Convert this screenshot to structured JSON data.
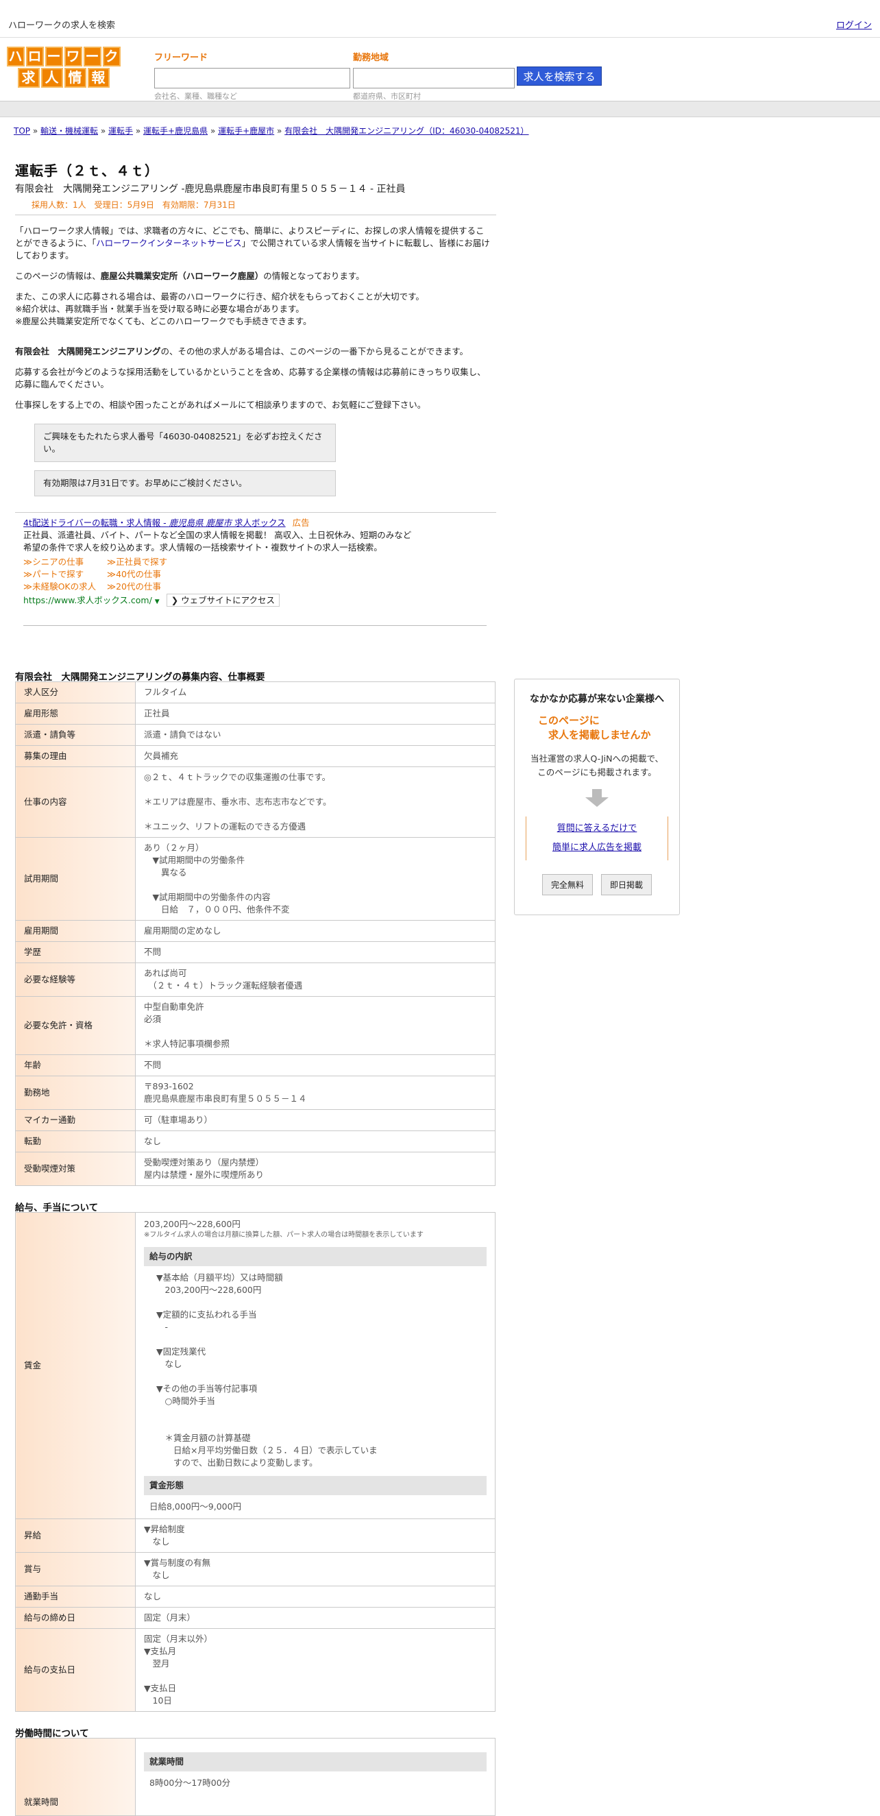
{
  "top": {
    "site_title": "ハローワークの求人を検索",
    "login": "ログイン"
  },
  "logo": {
    "row1": [
      "ハ",
      "ロ",
      "ー",
      "ワ",
      "ー",
      "ク"
    ],
    "row2": [
      "求",
      "人",
      "情",
      "報"
    ]
  },
  "search": {
    "keyword_label": "フリーワード",
    "keyword_placeholder": "会社名、業種、職種など",
    "keyword_value": "",
    "area_label": "勤務地域",
    "area_placeholder": "都道府県、市区町村",
    "area_value": "",
    "button": "求人を検索する"
  },
  "breadcrumb": {
    "items": [
      "TOP",
      "輸送・機械運転",
      "運転手",
      "運転手+鹿児島県",
      "運転手+鹿屋市",
      "有限会社　大隅開発エンジニアリング（ID：46030-04082521）"
    ],
    "sep": "»"
  },
  "job": {
    "title": "運転手（２ｔ、４ｔ）",
    "subtitle": "有限会社　大隅開発エンジニアリング -鹿児島県鹿屋市串良町有里５０５５－１４ - 正社員",
    "meta": "採用人数：1人　受理日：5月9日　有効期限：7月31日"
  },
  "intro": {
    "p1a": "「ハローワーク求人情報」では、求職者の方々に、どこでも、簡単に、よりスピーディに、お探しの求人情報を提供することができるように、「",
    "p1link": "ハローワークインターネットサービス",
    "p1b": "」で公開されている求人情報を当サイトに転載し、皆様にお届けしております。",
    "p2a": "このページの情報は、",
    "p2b": "鹿屋公共職業安定所（ハローワーク鹿屋）",
    "p2c": "の情報となっております。",
    "p3": "また、この求人に応募される場合は、最寄のハローワークに行き、紹介状をもらっておくことが大切です。",
    "p3b": "※紹介状は、再就職手当・就業手当を受け取る時に必要な場合があります。",
    "p3c": "※鹿屋公共職業安定所でなくても、どこのハローワークでも手続きできます。",
    "p4a": "有限会社　大隅開発エンジニアリング",
    "p4b": "の、その他の求人がある場合は、このページの一番下から見ることができます。",
    "p5": "応募する会社が今どのような採用活動をしているかということを含め、応募する企業様の情報は応募前にきっちり収集し、応募に臨んでください。",
    "p6": "仕事探しをする上での、相談や困ったことがあればメールにて相談承りますので、お気軽にご登録下さい。"
  },
  "notes": {
    "n1": "ご興味をもたれたら求人番号「46030-04082521」を必ずお控えください。",
    "n2": "有効期限は7月31日です。お早めにご検討ください。"
  },
  "ad": {
    "title_a": "4t配送ドライバーの転職・求人情報 - ",
    "title_b": "鹿児島県 鹿屋市",
    "title_c": " 求人ボックス",
    "badge": "広告",
    "desc1": "正社員、派遣社員、バイト、パートなど全国の求人情報を掲載！ 高収入、土日祝休み、短期のみなど",
    "desc2": "希望の条件で求人を絞り込めます。求人情報の一括検索サイト・複数サイトの求人一括検索。",
    "links": [
      "≫シニアの仕事",
      "≫正社員で探す",
      "≫パートで探す",
      "≫40代の仕事",
      "≫未経験OKの求人",
      "≫20代の仕事"
    ],
    "url": "https://www.求人ボックス.com/",
    "visit": "❯ ウェブサイトにアクセス"
  },
  "section1": {
    "title": "有限会社　大隅開発エンジニアリングの募集内容、仕事概要",
    "rows": [
      {
        "k": "求人区分",
        "v": [
          "フルタイム"
        ]
      },
      {
        "k": "雇用形態",
        "v": [
          "正社員"
        ]
      },
      {
        "k": "派遣・請負等",
        "v": [
          "派遣・請負ではない"
        ]
      },
      {
        "k": "募集の理由",
        "v": [
          "欠員補充"
        ]
      },
      {
        "k": "仕事の内容",
        "v": [
          "◎２ｔ、４ｔトラックでの収集運搬の仕事です。",
          "",
          "＊エリアは鹿屋市、垂水市、志布志市などです。",
          "",
          "＊ユニック、リフトの運転のできる方優遇"
        ]
      },
      {
        "k": "試用期間",
        "v": [
          "あり（２ヶ月）",
          "　▼試用期間中の労働条件",
          "　　異なる",
          "",
          "　▼試用期間中の労働条件の内容",
          "　　日給　７，０００円、他条件不変"
        ]
      },
      {
        "k": "雇用期間",
        "v": [
          "雇用期間の定めなし"
        ]
      },
      {
        "k": "学歴",
        "v": [
          "不問"
        ]
      },
      {
        "k": "必要な経験等",
        "v": [
          "あれば尚可",
          "　（２ｔ・４ｔ）トラック運転経験者優遇"
        ]
      },
      {
        "k": "必要な免許・資格",
        "v": [
          "中型自動車免許",
          "必須",
          "",
          "＊求人特記事項欄参照"
        ]
      },
      {
        "k": "年齢",
        "v": [
          "不問"
        ]
      },
      {
        "k": "勤務地",
        "v": [
          "〒893-1602",
          "鹿児島県鹿屋市串良町有里５０５５－１４"
        ]
      },
      {
        "k": "マイカー通勤",
        "v": [
          "可（駐車場あり）"
        ]
      },
      {
        "k": "転勤",
        "v": [
          "なし"
        ]
      },
      {
        "k": "受動喫煙対策",
        "v": [
          "受動喫煙対策あり（屋内禁煙）",
          "屋内は禁煙・屋外に喫煙所あり"
        ]
      }
    ]
  },
  "section2": {
    "title": "給与、手当について",
    "wage_key": "賃金",
    "wage_range": "203,200円〜228,600円",
    "wage_note": "※フルタイム求人の場合は月額に換算した額、パート求人の場合は時間額を表示しています",
    "breakdown_hdr": "給与の内訳",
    "breakdown": [
      "▼基本給（月額平均）又は時間額",
      "　203,200円〜228,600円",
      "",
      "▼定額的に支払われる手当",
      "　-",
      "",
      "▼固定残業代",
      "　なし",
      "",
      "▼その他の手当等付記事項",
      "　○時間外手当",
      "",
      "",
      "　＊賃金月額の計算基礎",
      "　　日給×月平均労働日数（２５．４日）で表示していま",
      "　　すので、出勤日数により変動します。"
    ],
    "form_hdr": "賃金形態",
    "form": "日給8,000円〜9,000円",
    "rows": [
      {
        "k": "昇給",
        "v": [
          "▼昇給制度",
          "　なし"
        ]
      },
      {
        "k": "賞与",
        "v": [
          "▼賞与制度の有無",
          "　なし"
        ]
      },
      {
        "k": "通勤手当",
        "v": [
          "なし"
        ]
      },
      {
        "k": "給与の締め日",
        "v": [
          "固定（月末）"
        ]
      },
      {
        "k": "給与の支払日",
        "v": [
          "固定（月末以外）",
          "▼支払月",
          "　翌月",
          "",
          "▼支払日",
          "　10日"
        ]
      }
    ]
  },
  "section3": {
    "title": "労働時間について",
    "key": "就業時間",
    "hdr": "就業時間",
    "line": "8時00分〜17時00分"
  },
  "side": {
    "title": "なかなか応募が来ない企業様へ",
    "catch1": "このページに",
    "catch2": "　求人を掲載しませんか",
    "desc1": "当社運営の求人Q-JiNへの掲載で、",
    "desc2": "このページにも掲載されます。",
    "link1": "質問に答えるだけで",
    "link2": "簡単に求人広告を掲載",
    "btn1": "完全無料",
    "btn2": "即日掲載"
  }
}
